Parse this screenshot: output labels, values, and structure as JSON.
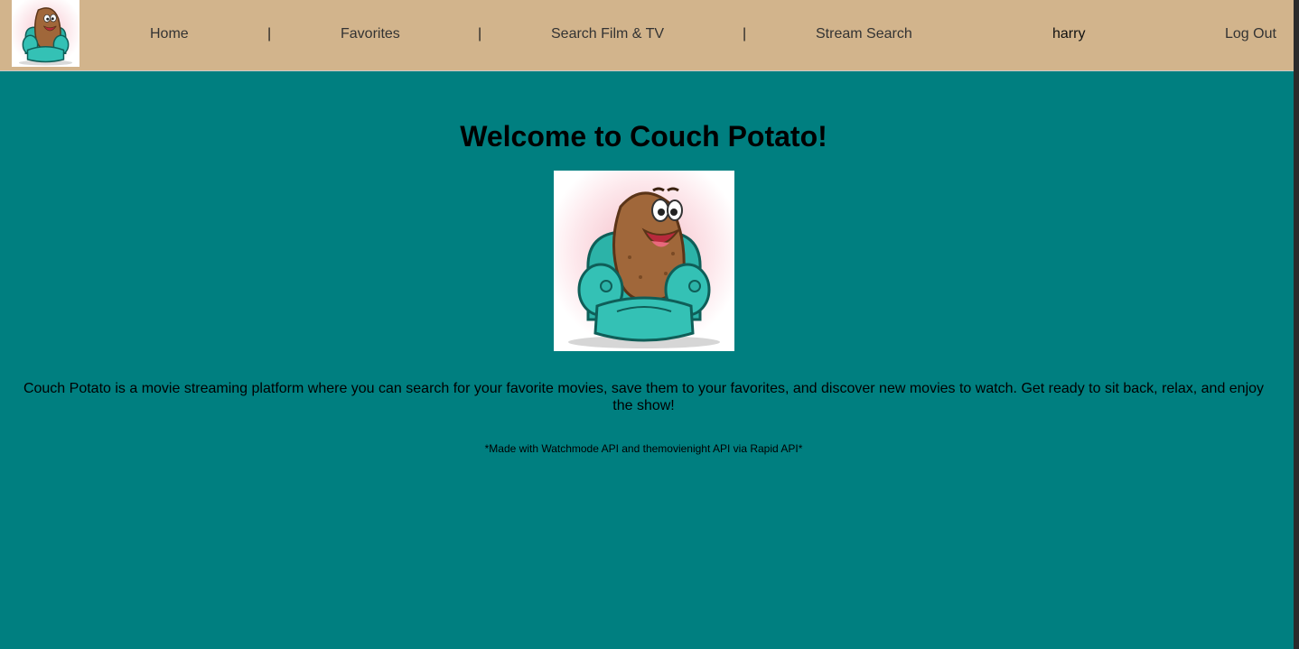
{
  "nav": {
    "logo_alt": "couch-potato-logo",
    "links": {
      "home": "Home",
      "favorites": "Favorites",
      "search_film_tv": "Search Film & TV",
      "stream_search": "Stream Search",
      "logout": "Log Out"
    },
    "separator": "|",
    "username": "harry"
  },
  "main": {
    "title": "Welcome to Couch Potato!",
    "description": "Couch Potato is a movie streaming platform where you can search for your favorite movies, save them to your favorites, and discover new movies to watch. Get ready to sit back, relax, and enjoy the show!",
    "credit": "*Made with Watchmode API and themovienight API via Rapid API*"
  },
  "colors": {
    "page_background": "#007f80",
    "navbar_background": "#d2b48c",
    "couch_teal": "#2cb3a8",
    "potato_brown": "#a0673a"
  }
}
